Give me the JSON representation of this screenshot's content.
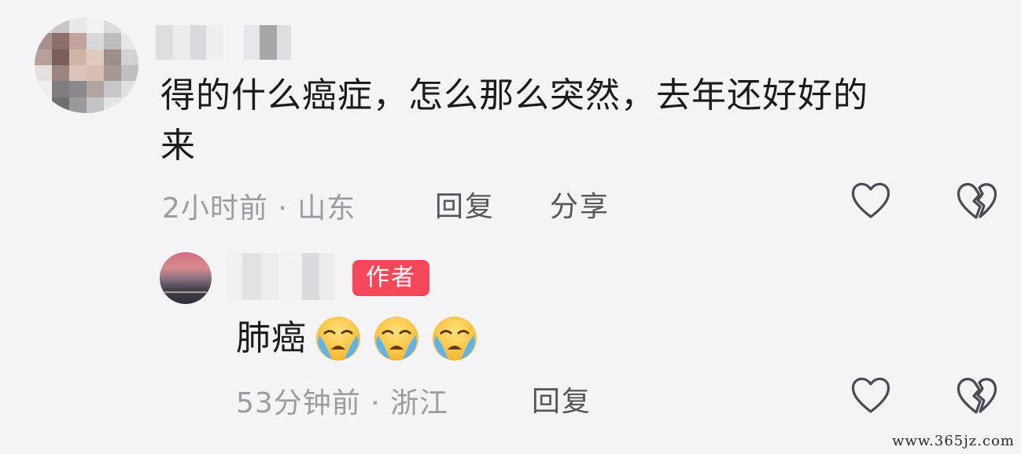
{
  "comments": [
    {
      "text_line1": "得的什么癌症，怎么那么突然，去年还好好的",
      "text_line2": "来",
      "time_location": "2小时前 · 山东",
      "reply_label": "回复",
      "share_label": "分享"
    }
  ],
  "reply": {
    "badge": "作者",
    "text": "肺癌",
    "emoji_count": 3,
    "time_location": "53分钟前 · 浙江",
    "reply_label": "回复"
  },
  "watermark": "www.365jz.com",
  "colors": {
    "badge": "#f4475a",
    "meta": "#9b9ba2",
    "text": "#1b1b1b",
    "background": "#f4f4f6"
  },
  "icons": [
    "heart-outline-icon",
    "broken-heart-icon",
    "crying-face-emoji"
  ]
}
